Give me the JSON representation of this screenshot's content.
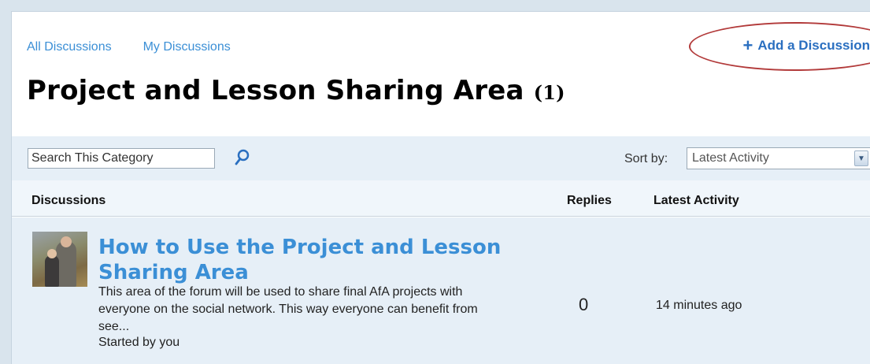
{
  "nav": {
    "all_discussions": "All Discussions",
    "my_discussions": "My Discussions",
    "add_discussion": "Add a Discussion"
  },
  "page": {
    "title": "Project and Lesson Sharing Area",
    "count": "(1)"
  },
  "toolbar": {
    "search_placeholder": "Search This Category",
    "sort_label": "Sort by:",
    "sort_value": "Latest Activity"
  },
  "table": {
    "headers": {
      "discussions": "Discussions",
      "replies": "Replies",
      "latest_activity": "Latest Activity"
    },
    "rows": [
      {
        "title": "How to Use the Project and Lesson Sharing Area",
        "excerpt": "This area of the forum will be used to share final AfA projects with everyone on the social network. This way everyone can benefit from see...",
        "started_by": "Started by you",
        "replies": "0",
        "latest_activity": "14 minutes ago"
      }
    ]
  },
  "colors": {
    "link": "#3b8fd6",
    "accent": "#2a6fc0",
    "highlight_ellipse": "#b23a3a",
    "toolbar_bg": "#e6eff7"
  },
  "icons": {
    "search": "search-icon",
    "plus": "plus-icon",
    "dropdown": "chevron-down-icon",
    "avatar": "avatar"
  }
}
